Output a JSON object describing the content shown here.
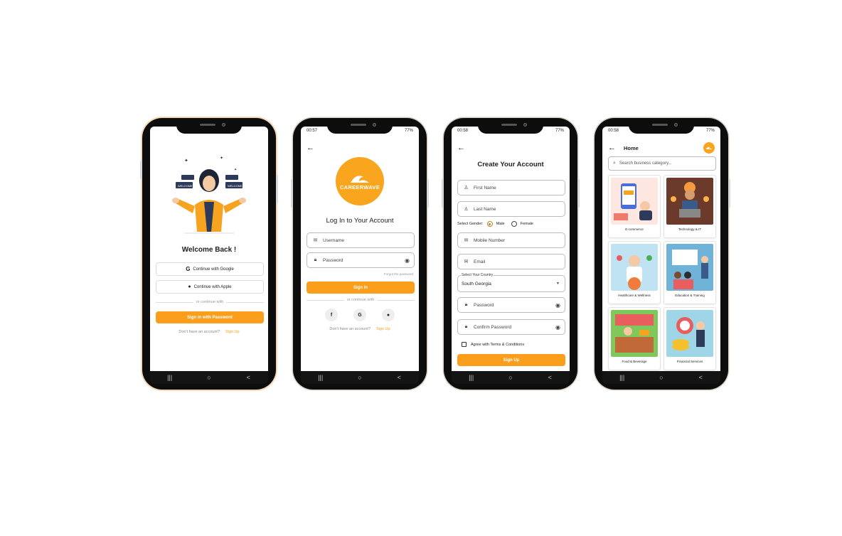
{
  "colors": {
    "accent": "#fb9e1b",
    "phone": "#0d0d0d"
  },
  "status": {
    "time2": "00:57",
    "time3": "00:58",
    "time4": "00:58",
    "battery": "77%"
  },
  "nav_icons": [
    "recent-apps-icon",
    "home-icon",
    "back-icon"
  ],
  "nav_glyphs": {
    "recent": "|||",
    "home": "○",
    "back": "<"
  },
  "welcome": {
    "bubble1": "WELCOME",
    "bubble2": "WELCOME",
    "title": "Welcome Back !",
    "google": "Continue with Google",
    "apple": "Continue with Apple",
    "divider": "or continue with",
    "password_btn": "Sign in with Password",
    "no_account": "Don't have an account?",
    "signup": "Sign Up"
  },
  "login": {
    "logo_text": "CAREERWAVE",
    "title": "Log In to Your Account",
    "username": "Username",
    "password": "Password",
    "forgot": "Forgot the password",
    "signin": "Sign In",
    "divider": "or continue with",
    "no_account": "Don't have an account?",
    "signup": "Sign Up"
  },
  "register": {
    "title": "Create Your Account",
    "first_name": "First Name",
    "last_name": "Last Name",
    "gender_label": "Select Gender:",
    "male": "Male",
    "female": "Female",
    "mobile": "Mobile Number",
    "email": "Email",
    "country_label": "Select Your Country",
    "country_value": "South Georgia",
    "password": "Password",
    "confirm_password": "Confirm Password",
    "agree": "Agree with Terms & Conditions",
    "signup": "Sign Up"
  },
  "home": {
    "title": "Home",
    "search_placeholder": "Search business category...",
    "categories": [
      {
        "label": "E-commerce",
        "color": "#fde7e0"
      },
      {
        "label": "Technology & IT",
        "color": "#6b3a2a"
      },
      {
        "label": "Healthcare & Wellness",
        "color": "#bfe3f2"
      },
      {
        "label": "Education & Training",
        "color": "#6fb3d8"
      },
      {
        "label": "Food & Beverage",
        "color": "#7fc95c"
      },
      {
        "label": "Financial Services",
        "color": "#9ed6e8"
      }
    ]
  }
}
